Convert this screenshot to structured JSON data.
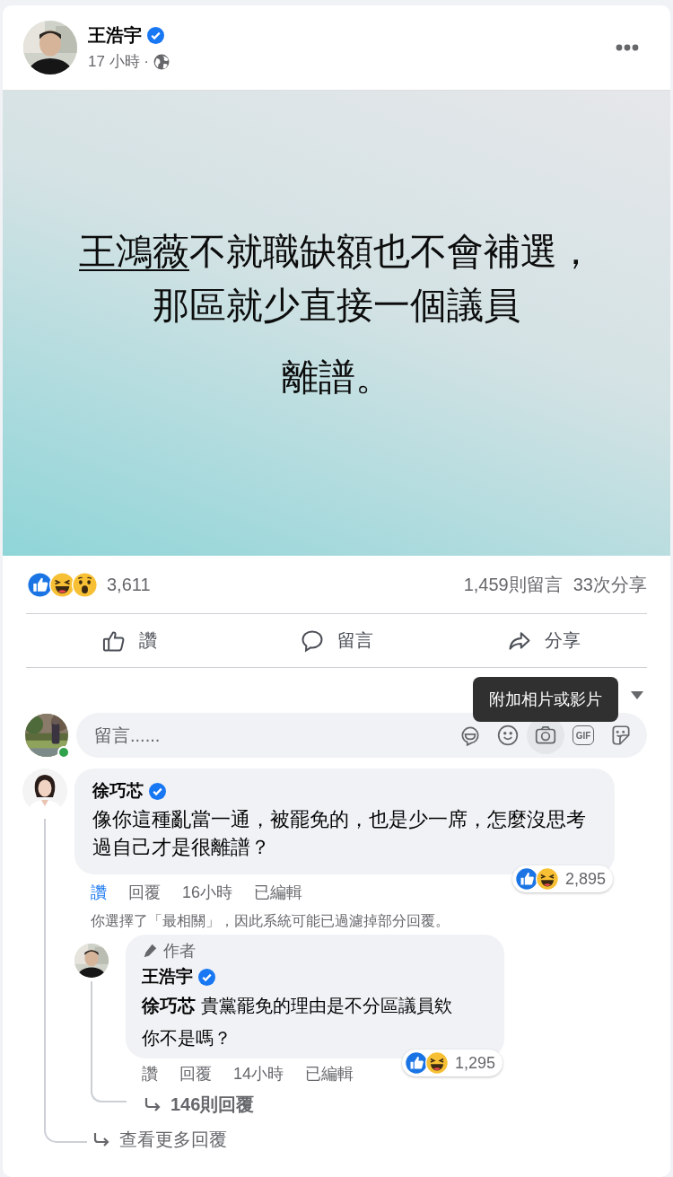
{
  "post": {
    "author": "王浩宇",
    "verified": true,
    "time": "17 小時 ·"
  },
  "banner": {
    "lines": [
      {
        "mention": "王鴻薇",
        "text": "不就職缺額也不會補選，"
      },
      {
        "text": "那區就少直接一個議員"
      },
      {
        "text": "離譜。"
      }
    ]
  },
  "stats": {
    "reactions": [
      {
        "kind": "like"
      },
      {
        "kind": "haha"
      },
      {
        "kind": "wow"
      }
    ],
    "count": "3,611",
    "comments": "1,459則留言",
    "shares": "33次分享"
  },
  "actions": [
    {
      "kind": "like",
      "label": "讚"
    },
    {
      "kind": "comment",
      "label": "留言"
    },
    {
      "kind": "share",
      "label": "分享"
    }
  ],
  "composer": {
    "placeholder": "留言......",
    "online": true,
    "tooltip": "附加相片或影片",
    "tools": [
      {
        "kind": "avatar",
        "hovered": false
      },
      {
        "kind": "emoji",
        "hovered": false
      },
      {
        "kind": "camera",
        "hovered": true
      },
      {
        "kind": "gif",
        "label": "GIF",
        "hovered": false
      },
      {
        "kind": "sticker",
        "hovered": false
      }
    ]
  },
  "comments": [
    {
      "author": "徐巧芯",
      "verified": true,
      "body": [
        "像你這種亂當一通，被罷免的，也是少一席，怎麼沒思考過自己才是很離譜？"
      ],
      "liked": true,
      "like": "讚",
      "reply": "回覆",
      "time": "16小時",
      "edited": "已編輯",
      "reactions": [
        {
          "kind": "like"
        },
        {
          "kind": "haha"
        }
      ],
      "reaction_count": "2,895",
      "notice": "你選擇了「最相關」，因此系統可能已過濾掉部分回覆。",
      "replies": [
        {
          "badge": "作者",
          "author": "王浩宇",
          "verified": true,
          "body": [
            "**徐巧芯** 貴黨罷免的理由是不分區議員欸",
            "你不是嗎？"
          ],
          "liked": false,
          "like": "讚",
          "reply": "回覆",
          "time": "14小時",
          "edited": "已編輯",
          "reactions": [
            {
              "kind": "like"
            },
            {
              "kind": "haha"
            }
          ],
          "reaction_count": "1,295",
          "more_replies": "146則回覆"
        }
      ],
      "more": "查看更多回覆"
    }
  ]
}
